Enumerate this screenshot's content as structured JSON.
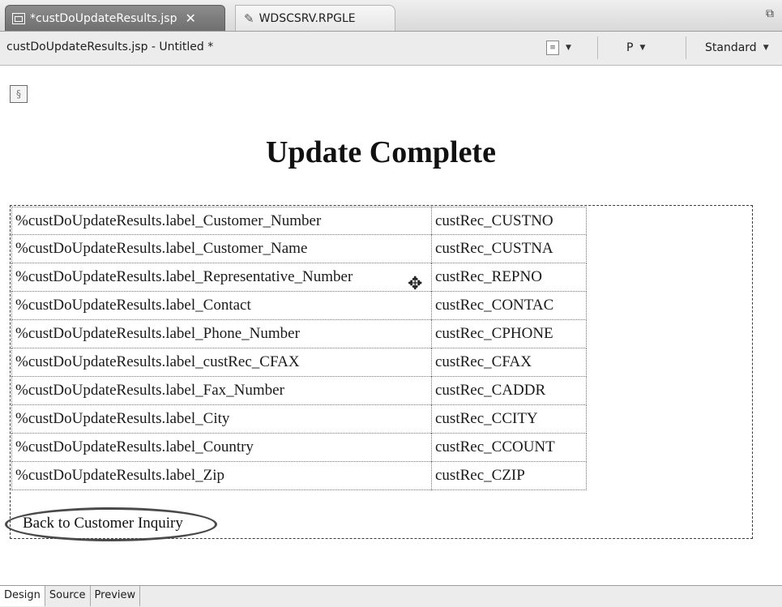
{
  "tabs": [
    {
      "label": "*custDoUpdateResults.jsp",
      "active": true
    },
    {
      "label": "WDSCSRV.RPGLE",
      "active": false
    }
  ],
  "header": {
    "title": "custDoUpdateResults.jsp - Untitled *",
    "paragraph_format": "P",
    "font": "Standard"
  },
  "page": {
    "heading": "Update Complete",
    "rows": [
      {
        "label": "%custDoUpdateResults.label_Customer_Number",
        "value": "custRec_CUSTNO"
      },
      {
        "label": "%custDoUpdateResults.label_Customer_Name",
        "value": "custRec_CUSTNA"
      },
      {
        "label": "%custDoUpdateResults.label_Representative_Number",
        "value": "custRec_REPNO"
      },
      {
        "label": "%custDoUpdateResults.label_Contact",
        "value": "custRec_CONTAC"
      },
      {
        "label": "%custDoUpdateResults.label_Phone_Number",
        "value": "custRec_CPHONE"
      },
      {
        "label": "%custDoUpdateResults.label_custRec_CFAX",
        "value": "custRec_CFAX"
      },
      {
        "label": "%custDoUpdateResults.label_Fax_Number",
        "value": "custRec_CADDR"
      },
      {
        "label": "%custDoUpdateResults.label_City",
        "value": "custRec_CCITY"
      },
      {
        "label": "%custDoUpdateResults.label_Country",
        "value": "custRec_CCOUNT"
      },
      {
        "label": "%custDoUpdateResults.label_Zip",
        "value": "custRec_CZIP"
      }
    ],
    "back_link": "Back to Customer Inquiry"
  },
  "bottom_tabs": [
    "Design",
    "Source",
    "Preview"
  ],
  "icons": {
    "tab_file": "jsp-file-icon",
    "tab_rpgle": "pencil-icon",
    "close": "close-icon",
    "maximize": "maximize-icon",
    "paragraph": "paragraph-icon",
    "move_cursor": "move-cursor-icon"
  }
}
